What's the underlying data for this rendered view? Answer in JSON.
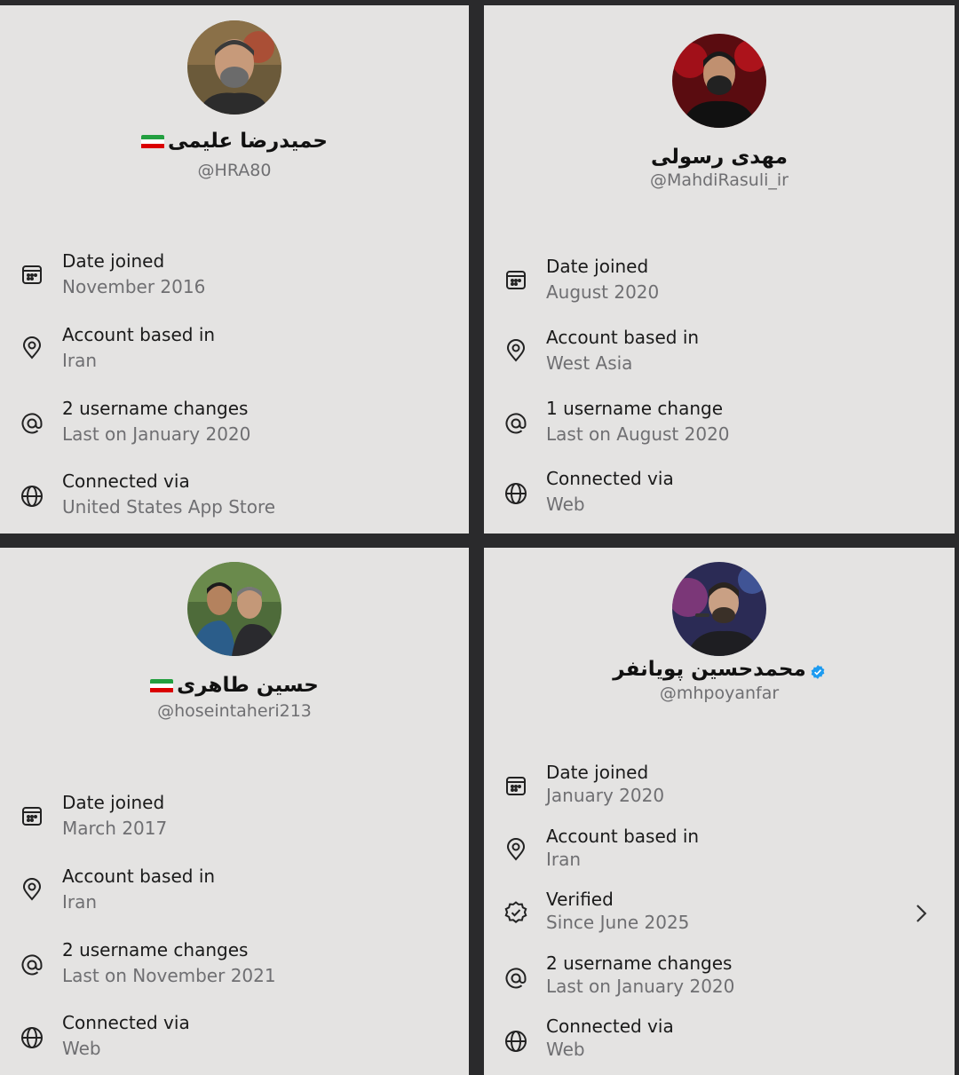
{
  "profiles": [
    {
      "name": "حمیدرضا علیمی",
      "handle": "@HRA80",
      "flag": true,
      "verified": false,
      "rows": [
        {
          "icon": "calendar-icon",
          "label": "Date joined",
          "value": "November 2016"
        },
        {
          "icon": "location-pin-icon",
          "label": "Account based in",
          "value": "Iran"
        },
        {
          "icon": "at-sign-icon",
          "label": "2 username changes",
          "value": "Last on January 2020"
        },
        {
          "icon": "globe-icon",
          "label": "Connected via",
          "value": "United States App Store"
        }
      ]
    },
    {
      "name": "مهدی رسولی",
      "handle": "@MahdiRasuli_ir",
      "flag": false,
      "verified": false,
      "rows": [
        {
          "icon": "calendar-icon",
          "label": "Date joined",
          "value": "August 2020"
        },
        {
          "icon": "location-pin-icon",
          "label": "Account based in",
          "value": "West Asia"
        },
        {
          "icon": "at-sign-icon",
          "label": "1 username change",
          "value": "Last on August 2020"
        },
        {
          "icon": "globe-icon",
          "label": "Connected via",
          "value": "Web"
        }
      ]
    },
    {
      "name": "حسین طاهری",
      "handle": "@hoseintaheri213",
      "flag": true,
      "verified": false,
      "rows": [
        {
          "icon": "calendar-icon",
          "label": "Date joined",
          "value": "March 2017"
        },
        {
          "icon": "location-pin-icon",
          "label": "Account based in",
          "value": "Iran"
        },
        {
          "icon": "at-sign-icon",
          "label": "2 username changes",
          "value": "Last on November 2021"
        },
        {
          "icon": "globe-icon",
          "label": "Connected via",
          "value": "Web"
        }
      ]
    },
    {
      "name": "محمدحسین پویانفر",
      "handle": "@mhpoyanfar",
      "flag": false,
      "verified": true,
      "rows": [
        {
          "icon": "calendar-icon",
          "label": "Date joined",
          "value": "January 2020"
        },
        {
          "icon": "location-pin-icon",
          "label": "Account based in",
          "value": "Iran"
        },
        {
          "icon": "verified-badge-icon",
          "label": "Verified",
          "value": "Since June 2025"
        },
        {
          "icon": "at-sign-icon",
          "label": "2 username changes",
          "value": "Last on January 2020"
        },
        {
          "icon": "globe-icon",
          "label": "Connected via",
          "value": "Web"
        }
      ]
    }
  ],
  "colors": {
    "panel_bg": "#e4e3e2",
    "divider": "#2a2a2c",
    "muted_text": "#6f6f72",
    "verified_blue": "#1d9bf0",
    "flag_green": "#239f40",
    "flag_red": "#da0000"
  }
}
